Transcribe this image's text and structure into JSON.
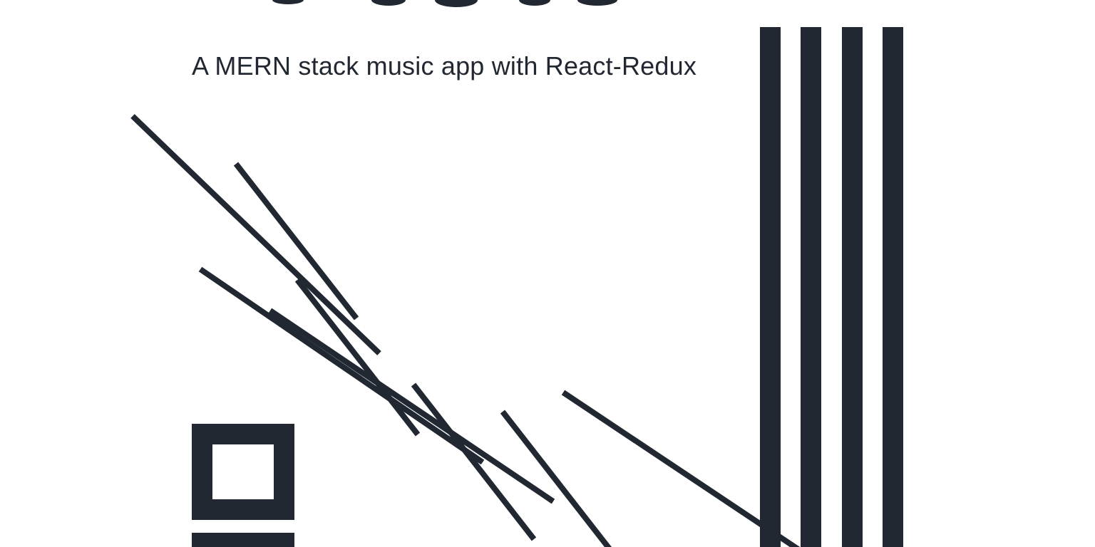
{
  "hero": {
    "subtitle": "A MERN stack music app with React-Redux"
  },
  "colors": {
    "ink": "#222831",
    "background": "#ffffff"
  }
}
